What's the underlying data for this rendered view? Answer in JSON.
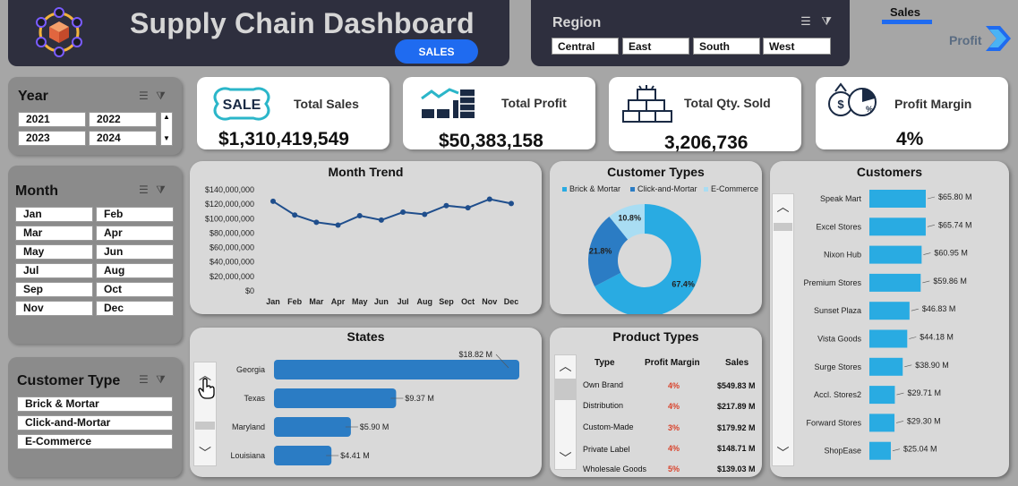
{
  "header": {
    "title": "Supply Chain Dashboard",
    "sales_button": "SALES"
  },
  "region": {
    "title": "Region",
    "options": [
      "Central",
      "East",
      "South",
      "West"
    ]
  },
  "nav": {
    "sales": "Sales",
    "profit": "Profit"
  },
  "year_slicer": {
    "title": "Year",
    "options": [
      "2021",
      "2022",
      "2023",
      "2024"
    ]
  },
  "month_slicer": {
    "title": "Month",
    "options": [
      "Jan",
      "Feb",
      "Mar",
      "Apr",
      "May",
      "Jun",
      "Jul",
      "Aug",
      "Sep",
      "Oct",
      "Nov",
      "Dec"
    ]
  },
  "customer_type_slicer": {
    "title": "Customer Type",
    "options": [
      "Brick & Mortar",
      "Click-and-Mortar",
      "E-Commerce"
    ]
  },
  "kpis": {
    "sales": {
      "label": "Total Sales",
      "value": "$1,310,419,549",
      "icon": "sale-tag-icon"
    },
    "profit": {
      "label": "Total Profit",
      "value": "$50,383,158",
      "icon": "growth-bars-icon"
    },
    "qty": {
      "label": "Total Qty. Sold",
      "value": "3,206,736",
      "icon": "boxes-icon"
    },
    "margin": {
      "label": "Profit Margin",
      "value": "4%",
      "icon": "money-pie-icon",
      "icon_text": "SALE"
    }
  },
  "month_trend": {
    "title": "Month Trend",
    "chart_data": {
      "type": "line",
      "title": "Month Trend",
      "categories": [
        "Jan",
        "Feb",
        "Mar",
        "Apr",
        "May",
        "Jun",
        "Jul",
        "Aug",
        "Sep",
        "Oct",
        "Nov",
        "Dec"
      ],
      "values": [
        124000000,
        105000000,
        95000000,
        91000000,
        104000000,
        98000000,
        109000000,
        106000000,
        118000000,
        115000000,
        127000000,
        121000000
      ],
      "yticks": [
        "$0",
        "$20,000,000",
        "$40,000,000",
        "$60,000,000",
        "$80,000,000",
        "$100,000,000",
        "$120,000,000",
        "$140,000,000"
      ],
      "ylim": [
        0,
        140000000
      ],
      "color": "#1f4e8c"
    }
  },
  "customer_types": {
    "title": "Customer Types",
    "chart_data": {
      "type": "pie",
      "title": "Customer Types",
      "labels": [
        "Brick & Mortar",
        "Click-and-Mortar",
        "E-Commerce"
      ],
      "values": [
        67.4,
        21.8,
        10.8
      ],
      "value_labels": [
        "67.4%",
        "21.8%",
        "10.8%"
      ],
      "colors": [
        "#29abe2",
        "#2b7cc4",
        "#a9ddf3"
      ],
      "legend": "top"
    }
  },
  "states": {
    "title": "States",
    "chart_data": {
      "type": "bar",
      "title": "States",
      "categories": [
        "Georgia",
        "Texas",
        "Maryland",
        "Louisiana"
      ],
      "values": [
        18.82,
        9.37,
        5.9,
        4.41
      ],
      "value_labels": [
        "$18.82 M",
        "$9.37 M",
        "$5.90 M",
        "$4.41 M"
      ],
      "color": "#2b7cc4"
    }
  },
  "product_types": {
    "title": "Product Types",
    "columns": [
      "Type",
      "Profit Margin",
      "Sales"
    ],
    "rows": [
      [
        "Own Brand",
        "4%",
        "$549.83 M"
      ],
      [
        "Distribution",
        "4%",
        "$217.89 M"
      ],
      [
        "Custom-Made",
        "3%",
        "$179.92 M"
      ],
      [
        "Private Label",
        "4%",
        "$148.71 M"
      ],
      [
        "Wholesale Goods",
        "5%",
        "$139.03 M"
      ]
    ]
  },
  "customers": {
    "title": "Customers",
    "chart_data": {
      "type": "bar",
      "title": "Customers",
      "categories": [
        "Speak Mart",
        "Excel Stores",
        "Nixon Hub",
        "Premium Stores",
        "Sunset Plaza",
        "Vista Goods",
        "Surge Stores",
        "Accl. Stores2",
        "Forward Stores",
        "ShopEase"
      ],
      "values": [
        65.8,
        65.74,
        60.95,
        59.86,
        46.83,
        44.18,
        38.9,
        29.71,
        29.3,
        25.04
      ],
      "value_labels": [
        "$65.80 M",
        "$65.74 M",
        "$60.95 M",
        "$59.86 M",
        "$46.83 M",
        "$44.18 M",
        "$38.90 M",
        "$29.71 M",
        "$29.30 M",
        "$25.04 M"
      ],
      "color": "#29abe2"
    }
  }
}
